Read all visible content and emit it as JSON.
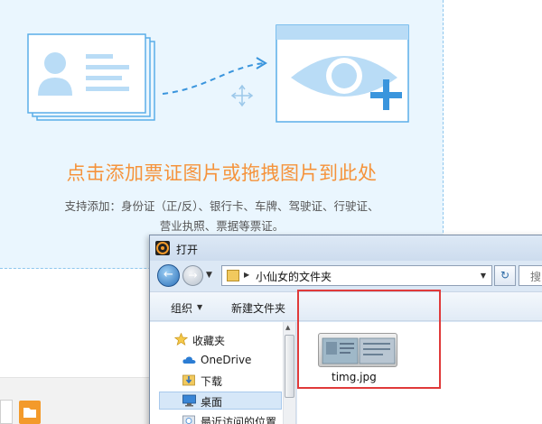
{
  "upload": {
    "title": "点击添加票证图片或拖拽图片到此处",
    "desc_line1": "支持添加：身份证（正/反）、银行卡、车牌、驾驶证、行驶证、",
    "desc_line2": "营业执照、票据等票证。"
  },
  "colors": {
    "accent_orange": "#f5933b",
    "accent_blue": "#5aaee8",
    "dropzone_bg": "#eaf6fe",
    "highlight_red": "#e03a3a"
  },
  "dialog": {
    "title": "打开",
    "address": {
      "path": "小仙女的文件夹",
      "search_placeholder": "搜"
    },
    "toolbar": {
      "organize": "组织",
      "new_folder": "新建文件夹"
    },
    "nav": [
      {
        "label": "收藏夹",
        "icon": "star-icon"
      },
      {
        "label": "OneDrive",
        "icon": "cloud-icon"
      },
      {
        "label": "下载",
        "icon": "download-folder-icon"
      },
      {
        "label": "桌面",
        "icon": "desktop-icon",
        "selected": true
      },
      {
        "label": "最近访问的位置",
        "icon": "recent-places-icon"
      }
    ],
    "files": [
      {
        "name": "timg.jpg",
        "icon": "image-thumbnail-icon"
      }
    ]
  }
}
